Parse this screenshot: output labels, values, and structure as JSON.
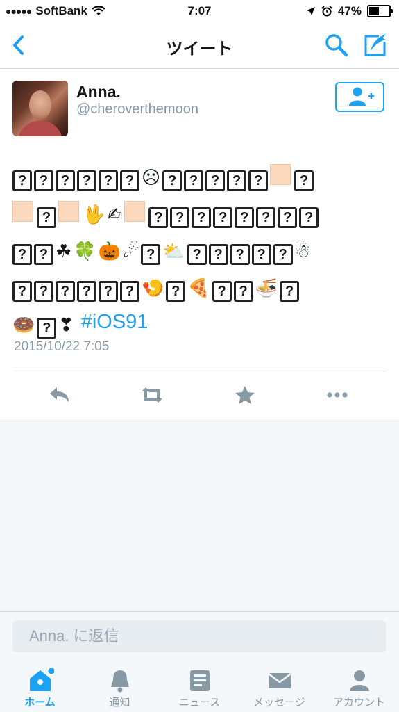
{
  "status_bar": {
    "carrier": "SoftBank",
    "time": "7:07",
    "battery": "47%",
    "battery_level": 0.47
  },
  "navbar": {
    "title": "ツイート"
  },
  "tweet": {
    "name": "Anna.",
    "handle": "@cheroverthemoon",
    "hashtag": "#iOS91",
    "date": "2015/10/22 7:05"
  },
  "reply": {
    "placeholder": "Anna. に返信"
  },
  "tabs": [
    {
      "label": "ホーム",
      "icon": "home-icon",
      "active": true
    },
    {
      "label": "通知",
      "icon": "bell-icon",
      "active": false
    },
    {
      "label": "ニュース",
      "icon": "news-icon",
      "active": false
    },
    {
      "label": "メッセージ",
      "icon": "envelope-icon",
      "active": false
    },
    {
      "label": "アカウント",
      "icon": "person-icon",
      "active": false
    }
  ],
  "colors": {
    "accent": "#1da1f2",
    "muted": "#8899a6",
    "background": "#f5f8fa"
  }
}
